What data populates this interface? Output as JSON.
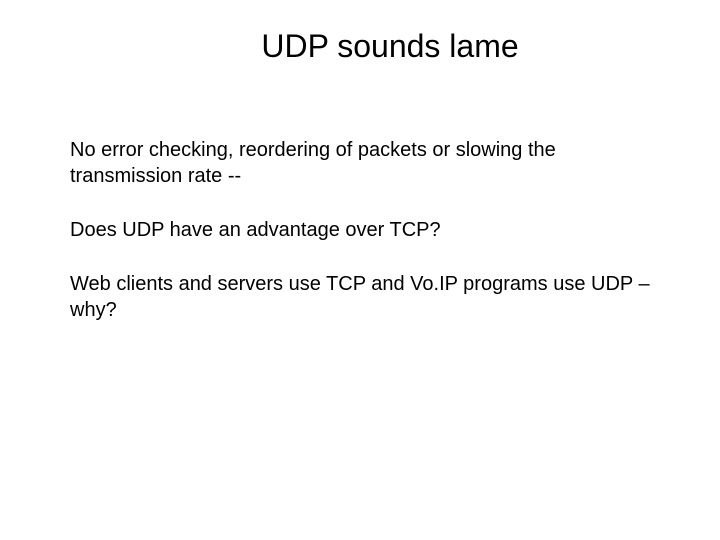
{
  "slide": {
    "title": "UDP sounds lame",
    "paragraphs": [
      "No error checking, reordering of packets or slowing the transmission rate --",
      "Does UDP have an advantage over TCP?",
      "Web clients and servers use TCP and Vo.IP programs use UDP – why?"
    ]
  }
}
